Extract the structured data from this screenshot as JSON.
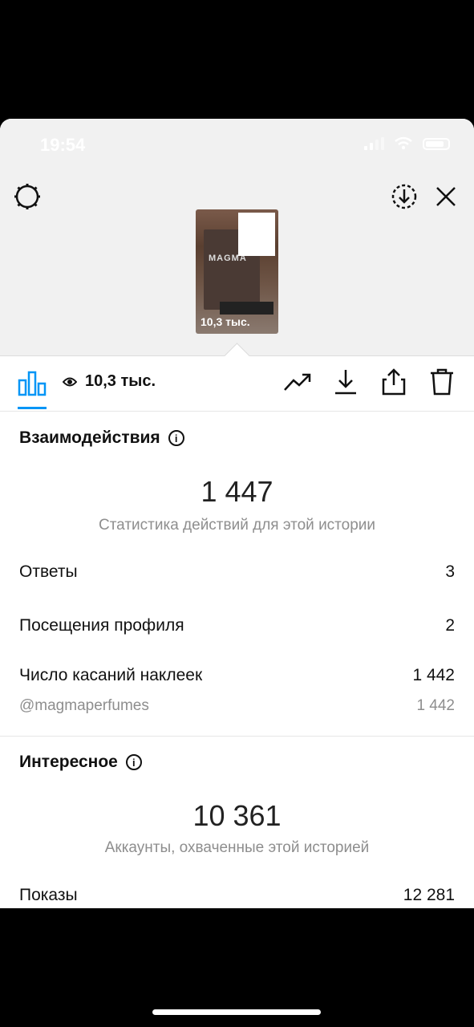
{
  "status": {
    "time": "19:54"
  },
  "story": {
    "thumbnail_brand": "MAGMA",
    "thumbnail_views": "10,3 тыс."
  },
  "toolbar": {
    "views": "10,3 тыс."
  },
  "interactions": {
    "title": "Взаимодействия",
    "total": "1 447",
    "subtitle": "Статистика действий для этой истории",
    "rows": [
      {
        "label": "Ответы",
        "value": "3"
      },
      {
        "label": "Посещения профиля",
        "value": "2"
      },
      {
        "label": "Число касаний наклеек",
        "value": "1 442"
      }
    ],
    "sticker": {
      "label": "@magmaperfumes",
      "value": "1 442"
    }
  },
  "discovery": {
    "title": "Интересное",
    "total": "10 361",
    "subtitle": "Аккаунты, охваченные этой историей",
    "rows": [
      {
        "label": "Показы",
        "value": "12 281"
      }
    ]
  },
  "colors": {
    "accent": "#0095f6",
    "muted": "#8e8e8e"
  }
}
